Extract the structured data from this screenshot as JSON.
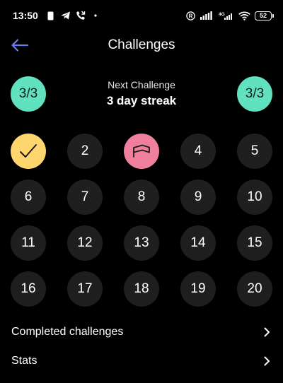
{
  "status_bar": {
    "time": "13:50",
    "network": "4G",
    "battery": "52"
  },
  "header": {
    "title": "Challenges"
  },
  "next_challenge": {
    "label": "Next Challenge",
    "name": "3 day streak",
    "progress_left": "3/3",
    "progress_right": "3/3"
  },
  "days": [
    {
      "label": "",
      "state": "completed",
      "icon": "check-icon"
    },
    {
      "label": "2",
      "state": "pending"
    },
    {
      "label": "",
      "state": "current",
      "icon": "ticket-icon"
    },
    {
      "label": "4",
      "state": "pending"
    },
    {
      "label": "5",
      "state": "pending"
    },
    {
      "label": "6",
      "state": "pending"
    },
    {
      "label": "7",
      "state": "pending"
    },
    {
      "label": "8",
      "state": "pending"
    },
    {
      "label": "9",
      "state": "pending"
    },
    {
      "label": "10",
      "state": "pending"
    },
    {
      "label": "11",
      "state": "pending"
    },
    {
      "label": "12",
      "state": "pending"
    },
    {
      "label": "13",
      "state": "pending"
    },
    {
      "label": "14",
      "state": "pending"
    },
    {
      "label": "15",
      "state": "pending"
    },
    {
      "label": "16",
      "state": "pending"
    },
    {
      "label": "17",
      "state": "pending"
    },
    {
      "label": "18",
      "state": "pending"
    },
    {
      "label": "19",
      "state": "pending"
    },
    {
      "label": "20",
      "state": "pending"
    }
  ],
  "menu": {
    "completed_label": "Completed challenges",
    "stats_label": "Stats"
  },
  "colors": {
    "background": "#000000",
    "accent_back": "#6b7cf0",
    "progress_badge": "#5fe2bd",
    "completed_day": "#ffd66e",
    "current_day": "#f07f9e",
    "pending_day": "#1f1f1f"
  }
}
